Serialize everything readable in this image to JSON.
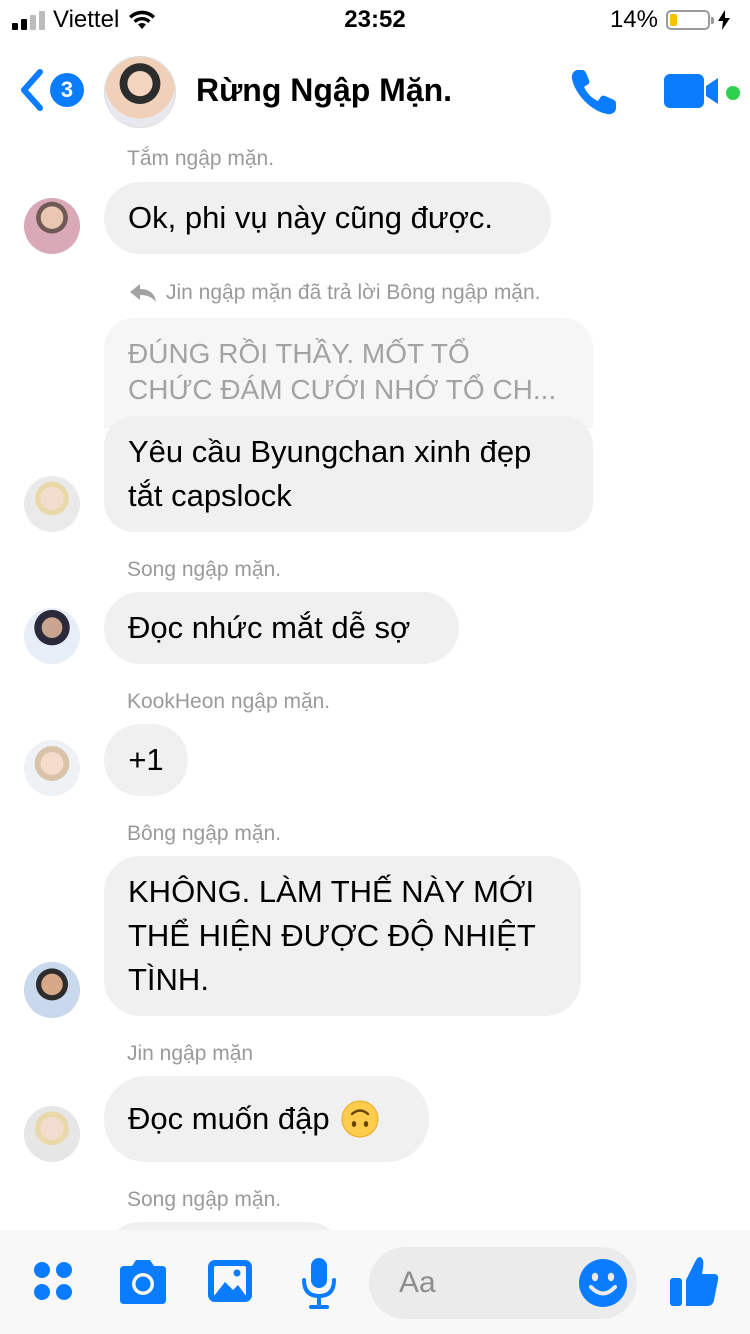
{
  "status_bar": {
    "carrier": "Viettel",
    "time": "23:52",
    "battery_percent": "14%",
    "battery_level": 0.14,
    "signal_bars": 2
  },
  "header": {
    "back_badge": "3",
    "title": "Rừng Ngập Mặn."
  },
  "messages": [
    {
      "sender": "Tắm ngập mặn.",
      "text": "Ok, phi vụ này cũng được."
    },
    {
      "reply_note": "Jin ngập mặn đã trả lời Bông ngập mặn.",
      "quote_line1": "ĐÚNG RỒI THẦY. MỐT TỔ",
      "quote_line2": "CHỨC ĐÁM CƯỚI NHỚ TỔ CH...",
      "line1": "Yêu cầu Byungchan xinh đẹp",
      "line2": "tắt capslock"
    },
    {
      "sender": "Song ngập mặn.",
      "text": "Đọc nhức mắt dễ sợ"
    },
    {
      "sender": "KookHeon ngập mặn.",
      "text": "+1"
    },
    {
      "sender": "Bông ngập mặn.",
      "line1": "KHÔNG. LÀM THẾ NÀY MỚI",
      "line2": "THỂ HIỆN ĐƯỢC ĐỘ NHIỆT",
      "line3": "TÌNH."
    },
    {
      "sender": "Jin ngập mặn",
      "text": "Đọc muốn đập",
      "emoji": "upside-down-face"
    },
    {
      "sender": "Song ngập mặn."
    }
  ],
  "composer": {
    "placeholder": "Aa",
    "icons": [
      "grid-menu-icon",
      "camera-icon",
      "image-icon",
      "microphone-icon",
      "emoji-icon",
      "thumbs-up-icon"
    ]
  },
  "colors": {
    "accent": "#0a7cff",
    "bubble": "#f1f0f0",
    "online": "#2bd250"
  }
}
